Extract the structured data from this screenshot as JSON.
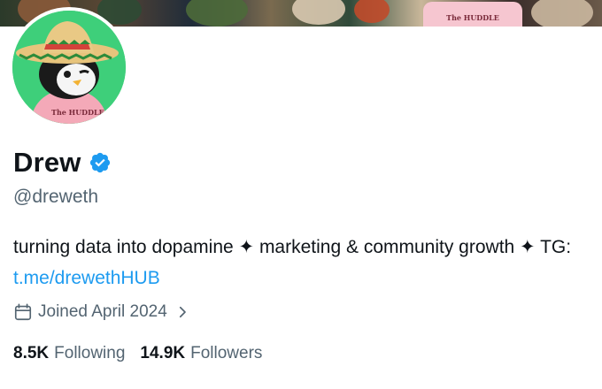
{
  "banner": {
    "badge_text": "The HUDDLE"
  },
  "avatar": {
    "badge_text": "The HUDDLE"
  },
  "profile": {
    "name": "Drew",
    "handle": "@dreweth",
    "bio_text": "turning data into dopamine ✦ marketing & community growth ✦ TG: ",
    "bio_link": "t.me/drewethHUB",
    "joined": "Joined April 2024",
    "following_count": "8.5K",
    "following_label": "Following",
    "followers_count": "14.9K",
    "followers_label": "Followers"
  },
  "colors": {
    "accent": "#1d9bf0",
    "text_primary": "#0f1419",
    "text_secondary": "#536471",
    "avatar_bg": "#3ecf7a"
  },
  "icons": {
    "verified": "verified-badge-icon",
    "calendar": "calendar-icon",
    "chevron": "chevron-right-icon"
  }
}
